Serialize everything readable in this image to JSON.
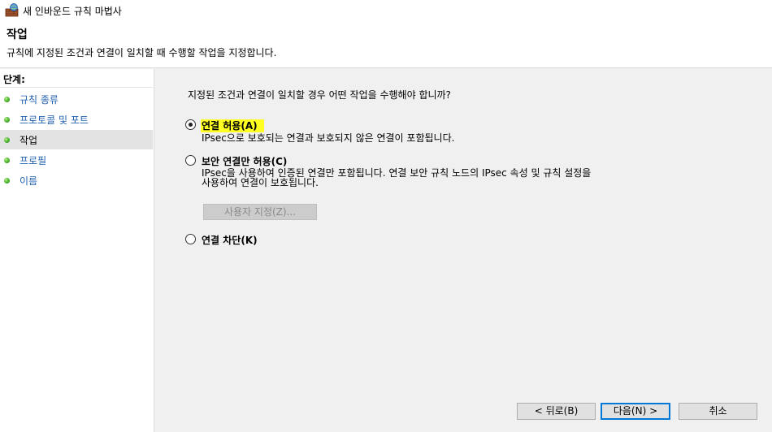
{
  "window": {
    "title": "새 인바운드 규칙 마법사",
    "icon": "firewall-icon"
  },
  "header": {
    "title": "작업",
    "description": "규칙에 지정된 조건과 연결이 일치할 때 수행할 작업을 지정합니다."
  },
  "sidebar": {
    "heading": "단계:",
    "items": [
      {
        "label": "규칙 종류",
        "active": false
      },
      {
        "label": "프로토콜 및 포트",
        "active": false
      },
      {
        "label": "작업",
        "active": true
      },
      {
        "label": "프로필",
        "active": false
      },
      {
        "label": "이름",
        "active": false
      }
    ]
  },
  "main": {
    "question": "지정된 조건과 연결이 일치할 경우 어떤 작업을 수행해야 합니까?",
    "options": [
      {
        "label": "연결 허용(A)",
        "description": "IPsec으로 보호되는 연결과 보호되지 않은 연결이 포함됩니다.",
        "checked": true,
        "highlight_color": "#ffff22"
      },
      {
        "label": "보안 연결만 허용(C)",
        "description_line1": "IPsec을 사용하여 인증된 연결만 포함됩니다. 연결 보안 규칙 노드의 IPsec 속성 및 규칙 설정을",
        "description_line2": "사용하여 연결이 보호됩니다.",
        "checked": false,
        "custom_button": "사용자 지정(Z)..."
      },
      {
        "label": "연결 차단(K)",
        "checked": false
      }
    ]
  },
  "footer": {
    "back": "< 뒤로(B)",
    "next": "다음(N) >",
    "cancel": "취소"
  }
}
